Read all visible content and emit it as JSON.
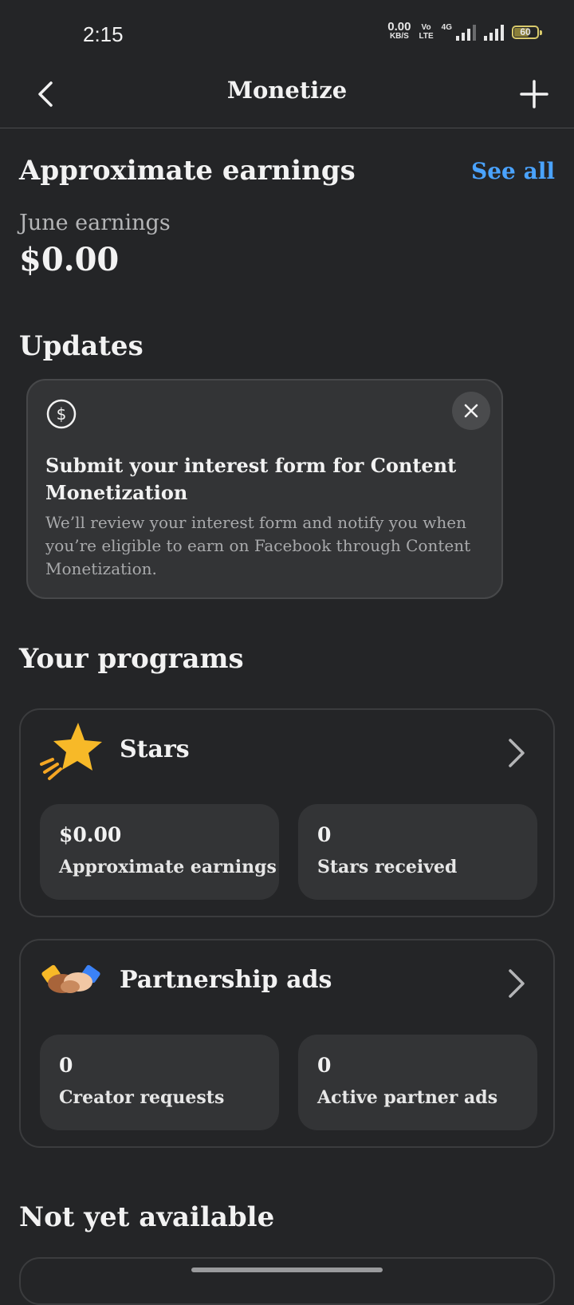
{
  "status_bar": {
    "time": "2:15",
    "net_speed_value": "0.00",
    "net_speed_unit": "KB/S",
    "volte_top": "Vo",
    "volte_bottom": "LTE",
    "network_type": "4G",
    "battery_level": "60"
  },
  "app_bar": {
    "title": "Monetize",
    "back_icon": "back-arrow-icon",
    "add_icon": "plus-icon"
  },
  "earnings": {
    "heading": "Approximate earnings",
    "see_all": "See all",
    "month_label": "June earnings",
    "amount": "$0.00"
  },
  "updates": {
    "heading": "Updates",
    "card": {
      "icon": "dollar-circle-icon",
      "title": "Submit your interest form for Content Monetization",
      "body": "We’ll review your interest form and notify you when you’re eligible to earn on Facebook through Content Monetization."
    }
  },
  "programs": {
    "heading": "Your programs",
    "items": [
      {
        "name": "Stars",
        "icon": "star-icon",
        "stats": [
          {
            "value": "$0.00",
            "label": "Approximate earnings"
          },
          {
            "value": "0",
            "label": "Stars received"
          }
        ]
      },
      {
        "name": "Partnership ads",
        "icon": "handshake-icon",
        "stats": [
          {
            "value": "0",
            "label": "Creator requests"
          },
          {
            "value": "0",
            "label": "Active partner ads"
          }
        ]
      }
    ]
  },
  "not_available": {
    "heading": "Not yet available"
  },
  "colors": {
    "background": "#242527",
    "card": "#333436",
    "accent_link": "#4aa3ff",
    "star_yellow": "#f7b928"
  }
}
